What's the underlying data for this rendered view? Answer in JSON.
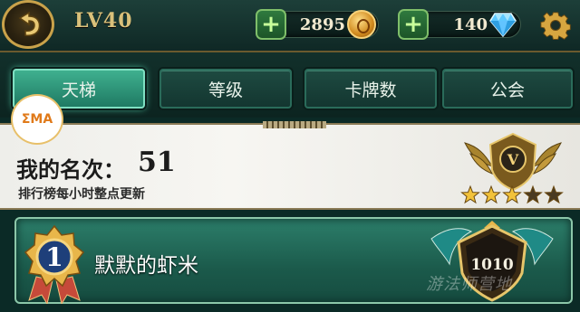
{
  "header": {
    "level": "LV40",
    "coins": "2895",
    "gems": "140"
  },
  "tabs": [
    {
      "label": "天梯",
      "active": true
    },
    {
      "label": "等级",
      "active": false
    },
    {
      "label": "卡牌数",
      "active": false
    },
    {
      "label": "公会",
      "active": false
    }
  ],
  "rank": {
    "label": "我的名次：",
    "value": "51",
    "note": "排行榜每小时整点更新",
    "tier": "V",
    "stars_filled": 3,
    "stars_total": 5
  },
  "player": {
    "position": "1",
    "name": "默默的虾米",
    "score": "1010"
  },
  "overlay": {
    "logo": "ΣMA",
    "watermark": "游法师营地"
  },
  "colors": {
    "accent_active_tab": "#3fb08f",
    "gold": "#d9c07a",
    "row_bg": "#2c7e6a"
  }
}
